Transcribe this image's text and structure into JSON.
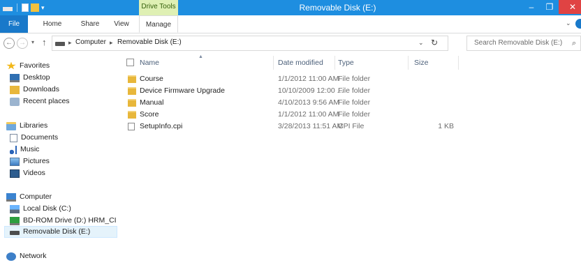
{
  "window": {
    "title": "Removable Disk (E:)",
    "context_tab": "Drive Tools",
    "minimize_glyph": "–",
    "maximize_glyph": "❐",
    "close_glyph": "✕"
  },
  "ribbon": {
    "tabs": [
      "File",
      "Home",
      "Share",
      "View",
      "Manage"
    ],
    "collapse_glyph": "⌄"
  },
  "address": {
    "breadcrumb": [
      "Computer",
      "Removable Disk (E:)"
    ],
    "separator": "▸",
    "back_glyph": "←",
    "forward_glyph": "→",
    "recent_glyph": "▾",
    "up_glyph": "↑",
    "dropdown_glyph": "⌄",
    "refresh_glyph": "↻"
  },
  "search": {
    "placeholder": "Search Removable Disk (E:)",
    "icon_glyph": "⌕"
  },
  "navpane": {
    "favorites": {
      "label": "Favorites",
      "items": [
        "Desktop",
        "Downloads",
        "Recent places"
      ]
    },
    "libraries": {
      "label": "Libraries",
      "items": [
        "Documents",
        "Music",
        "Pictures",
        "Videos"
      ]
    },
    "computer": {
      "label": "Computer",
      "items": [
        "Local Disk (C:)",
        "BD-ROM Drive (D:) HRM_CI",
        "Removable Disk (E:)"
      ]
    },
    "network": {
      "label": "Network"
    }
  },
  "columns": {
    "name": "Name",
    "date": "Date modified",
    "type": "Type",
    "size": "Size",
    "sort_glyph": "▲"
  },
  "files": [
    {
      "name": "Course",
      "date": "1/1/2012 11:00 AM",
      "type": "File folder",
      "size": ""
    },
    {
      "name": "Device Firmware Upgrade",
      "date": "10/10/2009 12:00 ...",
      "type": "File folder",
      "size": ""
    },
    {
      "name": "Manual",
      "date": "4/10/2013 9:56 AM",
      "type": "File folder",
      "size": ""
    },
    {
      "name": "Score",
      "date": "1/1/2012 11:00 AM",
      "type": "File folder",
      "size": ""
    },
    {
      "name": "SetupInfo.cpi",
      "date": "3/28/2013 11:51 AM",
      "type": "CPI File",
      "size": "1 KB"
    }
  ],
  "colors": {
    "titlebar": "#1e8ee0",
    "file_tab": "#1979ca",
    "drive_tools": "#dff0b4",
    "close_button": "#e04343",
    "selection": "#e5f3fb",
    "folder": "#e8b73b"
  }
}
